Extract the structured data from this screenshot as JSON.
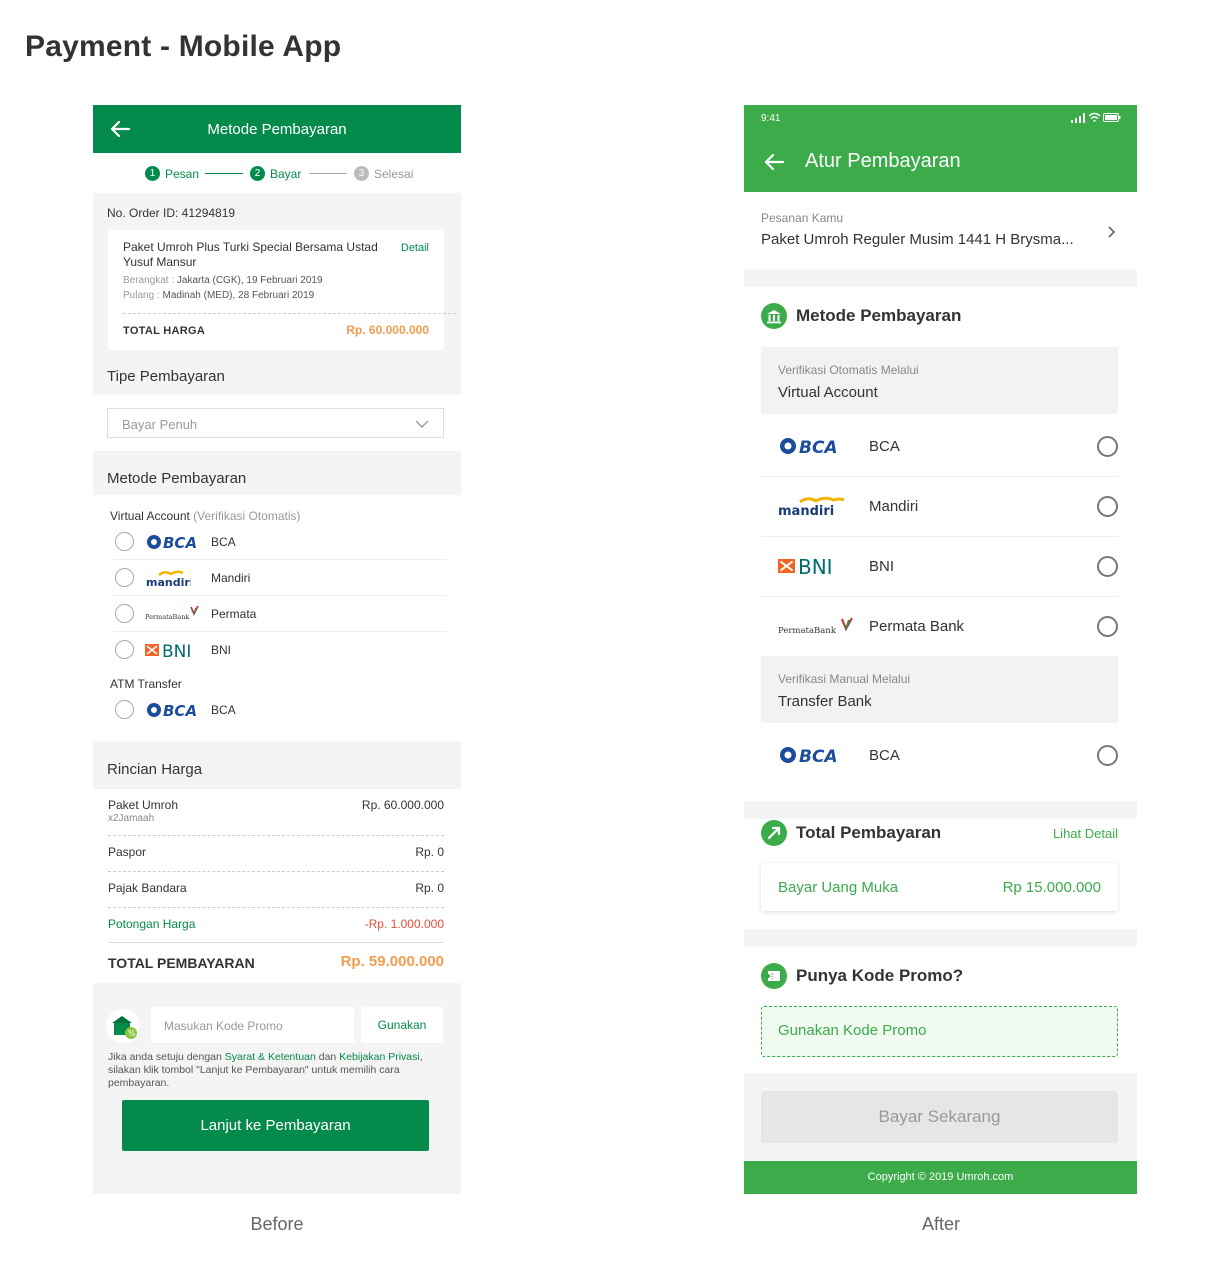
{
  "page_title": "Payment - Mobile App",
  "captions": {
    "before": "Before",
    "after": "After"
  },
  "colors": {
    "before_green": "#048a4a",
    "after_green": "#3cab4a",
    "price_orange": "#f39c4d",
    "promo_red": "#e74c3c"
  },
  "before": {
    "header_title": "Metode Pembayaran",
    "steps": [
      {
        "num": "1",
        "label": "Pesan"
      },
      {
        "num": "2",
        "label": "Bayar"
      },
      {
        "num": "3",
        "label": "Selesai"
      }
    ],
    "order_id": "No. Order ID: 41294819",
    "package": {
      "name": "Paket Umroh Plus Turki Special Bersama Ustad Yusuf Mansur",
      "detail_link": "Detail",
      "depart_label": "Berangkat : ",
      "depart_value": "Jakarta (CGK), 19 Februari 2019",
      "return_label": "Pulang : ",
      "return_value": "Madinah (MED), 28 Februari 2019",
      "total_label": "TOTAL HARGA",
      "total_value": "Rp. 60.000.000"
    },
    "payment_type": {
      "title": "Tipe Pembayaran",
      "selected": "Bayar Penuh"
    },
    "payment_method": {
      "title": "Metode Pembayaran",
      "va_label": "Virtual Account",
      "va_note": "(Verifikasi Otomatis)",
      "va_banks": [
        {
          "icon": "bca-logo",
          "logo": "BCA",
          "name": "BCA"
        },
        {
          "icon": "mandiri-logo",
          "logo": "mandiri",
          "name": "Mandiri"
        },
        {
          "icon": "permata-logo",
          "logo": "PermataBank",
          "name": "Permata"
        },
        {
          "icon": "bni-logo",
          "logo": "BNI",
          "name": "BNI"
        }
      ],
      "atm_label": "ATM Transfer",
      "atm_banks": [
        {
          "icon": "bca-logo",
          "logo": "BCA",
          "name": "BCA"
        }
      ]
    },
    "price_details": {
      "title": "Rincian Harga",
      "rows": [
        {
          "label": "Paket Umroh",
          "sub": "x2Jamaah",
          "value": "Rp. 60.000.000"
        },
        {
          "label": "Paspor",
          "value": "Rp. 0"
        },
        {
          "label": "Pajak Bandara",
          "value": "Rp. 0"
        },
        {
          "label": "Potongan Harga",
          "value": "-Rp. 1.000.000"
        }
      ],
      "total_label": "TOTAL PEMBAYARAN",
      "total_value": "Rp. 59.000.000"
    },
    "promo": {
      "placeholder": "Masukan Kode Promo",
      "button": "Gunakan"
    },
    "terms": {
      "t1": "Jika anda setuju dengan ",
      "link1": "Syarat & Ketentuan",
      "t2": " dan ",
      "link2": "Kebijakan Privasi",
      "t3": ", silakan klik tombol \"Lanjut ke Pembayaran\" untuk memilih cara pembayaran."
    },
    "cta": "Lanjut ke Pembayaran"
  },
  "after": {
    "status_time": "9:41",
    "header_title": "Atur Pembayaran",
    "order": {
      "label": "Pesanan Kamu",
      "package": "Paket Umroh Reguler Musim 1441 H Brysma..."
    },
    "payment_method": {
      "title": "Metode Pembayaran",
      "va_small": "Verifikasi Otomatis Melalui",
      "va_label": "Virtual Account",
      "va_banks": [
        {
          "icon": "bca-logo",
          "logo": "BCA",
          "name": "BCA"
        },
        {
          "icon": "mandiri-logo",
          "logo": "mandiri",
          "name": "Mandiri"
        },
        {
          "icon": "bni-logo",
          "logo": "BNI",
          "name": "BNI"
        },
        {
          "icon": "permata-logo",
          "logo": "PermataBank",
          "name": "Permata Bank"
        }
      ],
      "manual_small": "Verifikasi Manual Melalui",
      "manual_label": "Transfer Bank",
      "manual_banks": [
        {
          "icon": "bca-logo",
          "logo": "BCA",
          "name": "BCA"
        }
      ]
    },
    "total": {
      "title": "Total Pembayaran",
      "link": "Lihat Detail",
      "pay_label": "Bayar Uang Muka",
      "pay_value": "Rp 15.000.000"
    },
    "promo": {
      "title": "Punya Kode Promo?",
      "button": "Gunakan Kode Promo"
    },
    "cta": "Bayar Sekarang",
    "footer": "Copyright © 2019 Umroh.com"
  }
}
